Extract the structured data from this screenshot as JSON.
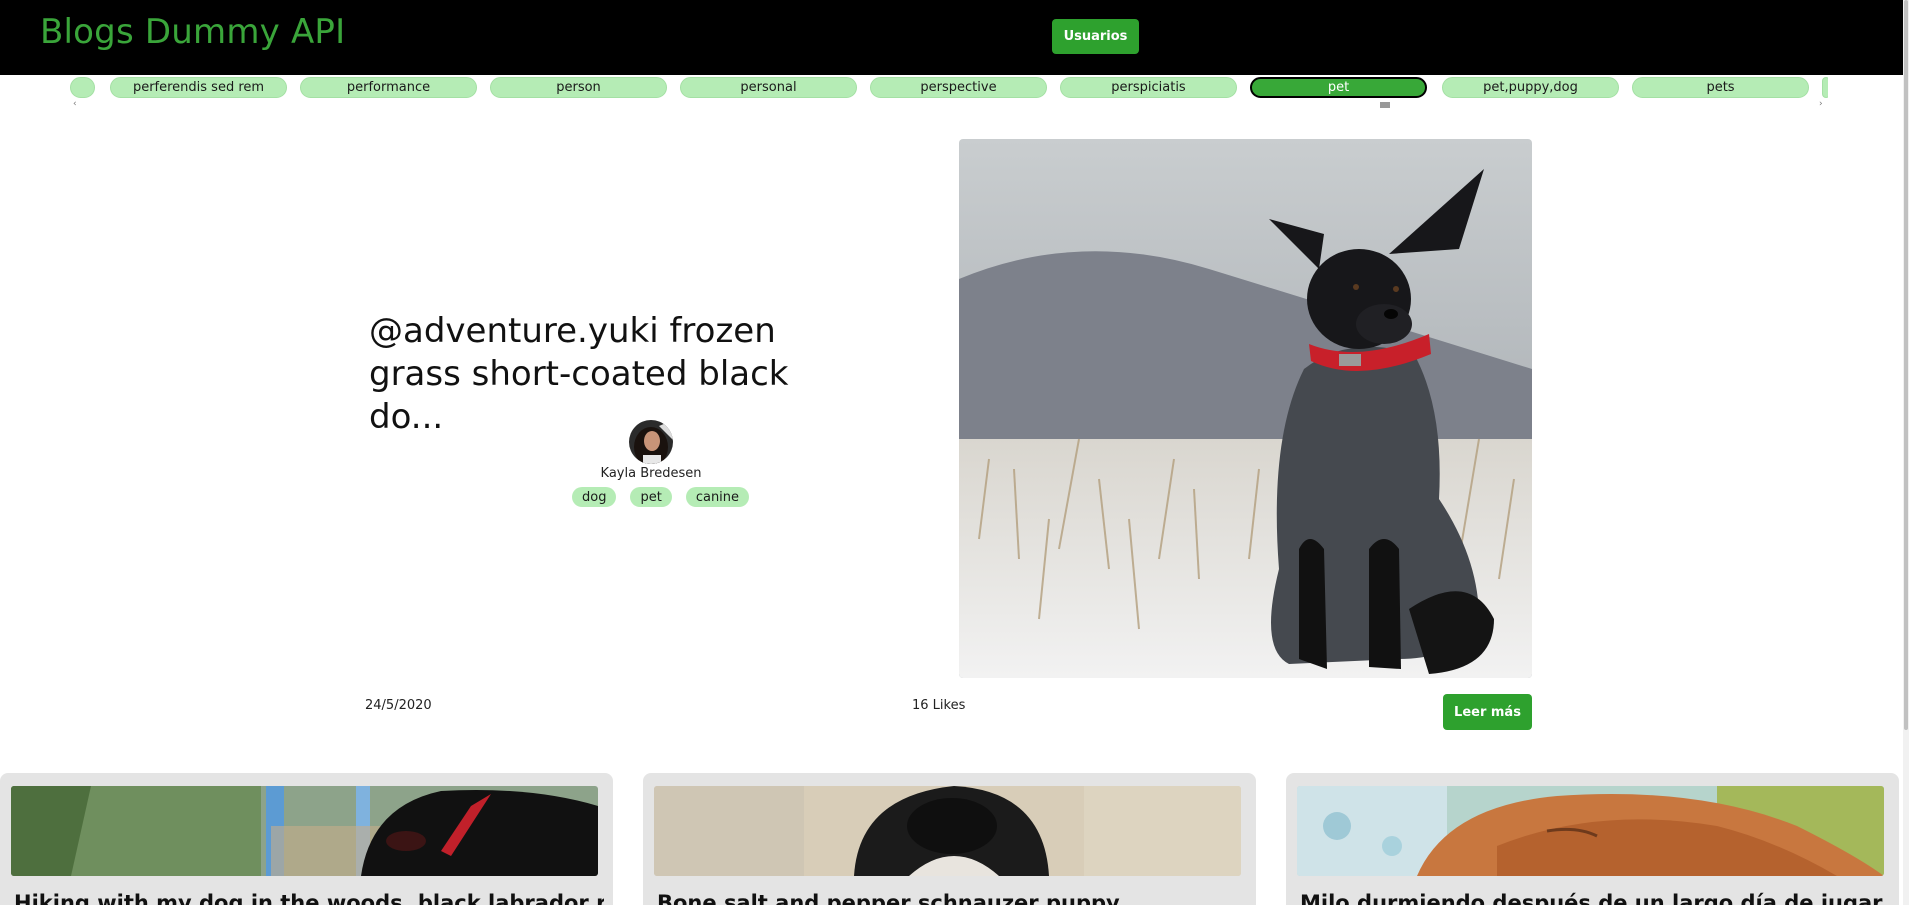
{
  "header": {
    "brand": "Blogs Dummy API",
    "nav_button": "Usuarios"
  },
  "tag_carousel": {
    "tags": [
      {
        "label": "",
        "active": false
      },
      {
        "label": "perferendis sed rem",
        "active": false
      },
      {
        "label": "performance",
        "active": false
      },
      {
        "label": "person",
        "active": false
      },
      {
        "label": "personal",
        "active": false
      },
      {
        "label": "perspective",
        "active": false
      },
      {
        "label": "perspiciatis",
        "active": false
      },
      {
        "label": "pet",
        "active": true
      },
      {
        "label": "pet,puppy,dog",
        "active": false
      },
      {
        "label": "pets",
        "active": false
      },
      {
        "label": "",
        "active": false
      }
    ],
    "arrow_left": "‹",
    "arrow_right": "›"
  },
  "featured": {
    "title": "@adventure.yuki frozen grass short-coated black do...",
    "author": "Kayla Bredesen",
    "tags": [
      "dog",
      "pet",
      "canine"
    ],
    "date": "24/5/2020",
    "likes": "16 Likes",
    "read_more": "Leer más",
    "image_alt": "black dog in red collar sitting on snowy grass"
  },
  "cards": [
    {
      "title": "Hiking with my dog in the woods. black labrador re..."
    },
    {
      "title": "Bone salt and pepper schnauzer puppy"
    },
    {
      "title": "Milo durmiendo después de un largo día de jugar en..."
    }
  ],
  "colors": {
    "accent": "#2ea12e",
    "brand": "#3aa53a",
    "chip": "#b5ecb5",
    "header_bg": "#000000",
    "card_bg": "#e4e4e4"
  }
}
